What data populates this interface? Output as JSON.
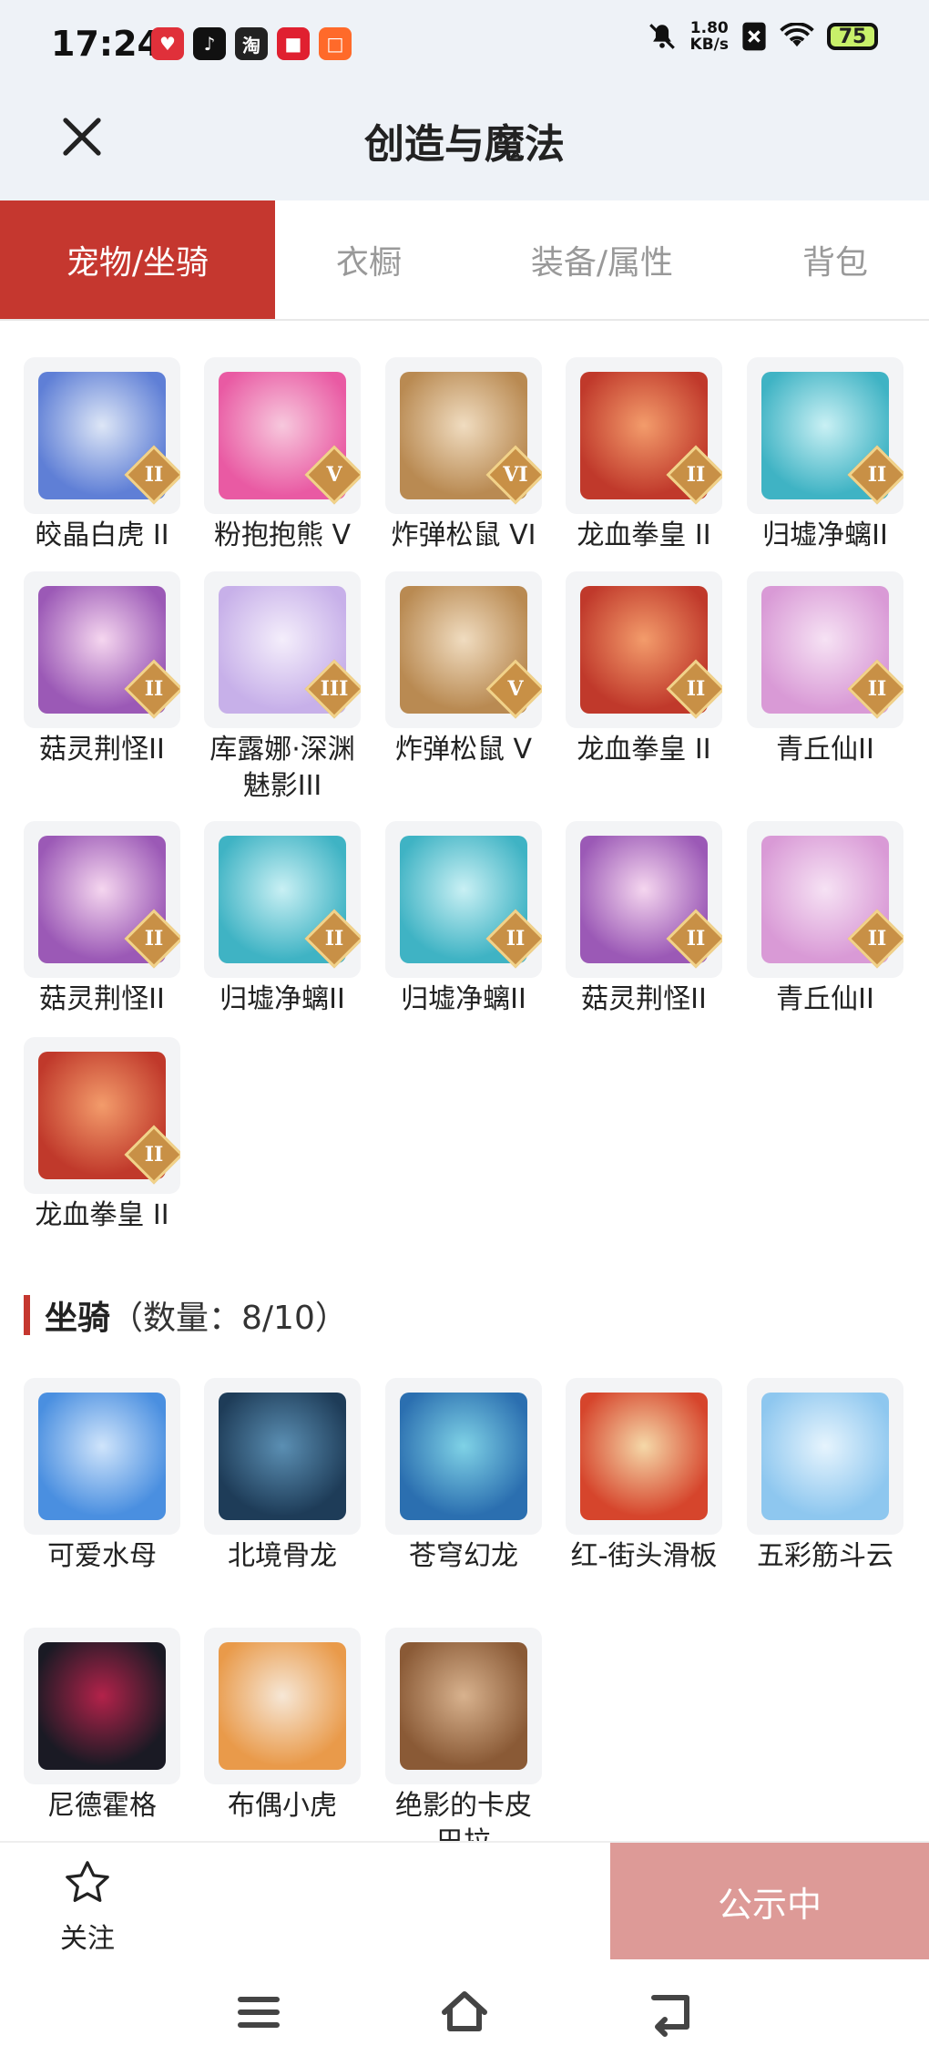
{
  "status_bar": {
    "time": "17:24",
    "net_speed_value": "1.80",
    "net_speed_unit": "KB/s",
    "battery": "75",
    "apps": [
      {
        "glyph": "♥",
        "color": "#e0303a"
      },
      {
        "glyph": "♪",
        "color": "#111111"
      },
      {
        "glyph": "淘",
        "color": "#222222"
      },
      {
        "glyph": "■",
        "color": "#e02030"
      },
      {
        "glyph": "□",
        "color": "#ff6a2a"
      }
    ]
  },
  "header": {
    "title": "创造与魔法"
  },
  "tabs": [
    {
      "label": "宠物/坐骑",
      "active": true
    },
    {
      "label": "衣橱",
      "active": false
    },
    {
      "label": "装备/属性",
      "active": false
    },
    {
      "label": "背包",
      "active": false
    }
  ],
  "pets": [
    {
      "name": "皎晶白虎 II",
      "badge": "II",
      "colors": [
        "#5f7fd6",
        "#dde6f6"
      ]
    },
    {
      "name": "粉抱抱熊 V",
      "badge": "V",
      "colors": [
        "#e95aa3",
        "#f7c8dd"
      ]
    },
    {
      "name": "炸弹松鼠 VI",
      "badge": "VI",
      "colors": [
        "#b98a52",
        "#f0dcc0"
      ]
    },
    {
      "name": "龙血拳皇 II",
      "badge": "II",
      "colors": [
        "#c0392b",
        "#f39c6b"
      ]
    },
    {
      "name": "归墟净螭II",
      "badge": "II",
      "colors": [
        "#3fb3c4",
        "#c9f0f4"
      ]
    },
    {
      "name": "菇灵荆怪II",
      "badge": "II",
      "colors": [
        "#9b59b6",
        "#f5d6ef"
      ]
    },
    {
      "name": "库露娜·深渊魅影III",
      "badge": "III",
      "colors": [
        "#c7b0e9",
        "#f4eefb"
      ]
    },
    {
      "name": "炸弹松鼠 V",
      "badge": "V",
      "colors": [
        "#b98a52",
        "#f0dcc0"
      ]
    },
    {
      "name": "龙血拳皇 II",
      "badge": "II",
      "colors": [
        "#c0392b",
        "#f39c6b"
      ]
    },
    {
      "name": "青丘仙II",
      "badge": "II",
      "colors": [
        "#d99ad6",
        "#f6e2f4"
      ]
    },
    {
      "name": "菇灵荆怪II",
      "badge": "II",
      "colors": [
        "#9b59b6",
        "#f5d6ef"
      ]
    },
    {
      "name": "归墟净螭II",
      "badge": "II",
      "colors": [
        "#3fb3c4",
        "#c9f0f4"
      ]
    },
    {
      "name": "归墟净螭II",
      "badge": "II",
      "colors": [
        "#3fb3c4",
        "#c9f0f4"
      ]
    },
    {
      "name": "菇灵荆怪II",
      "badge": "II",
      "colors": [
        "#9b59b6",
        "#f5d6ef"
      ]
    },
    {
      "name": "青丘仙II",
      "badge": "II",
      "colors": [
        "#d99ad6",
        "#f6e2f4"
      ]
    },
    {
      "name": "龙血拳皇 II",
      "badge": "II",
      "colors": [
        "#c0392b",
        "#f39c6b"
      ]
    }
  ],
  "mounts_section": {
    "title": "坐骑",
    "count_label": "（数量：8/10）"
  },
  "mounts": [
    {
      "name": "可爱水母",
      "colors": [
        "#4a8fe0",
        "#cfe4fb"
      ]
    },
    {
      "name": "北境骨龙",
      "colors": [
        "#1e3c58",
        "#5b8fb3"
      ]
    },
    {
      "name": "苍穹幻龙",
      "colors": [
        "#2b6fb0",
        "#7fd2e6"
      ]
    },
    {
      "name": "红-街头滑板",
      "colors": [
        "#d6452c",
        "#f5d8a8"
      ]
    },
    {
      "name": "五彩筋斗云",
      "colors": [
        "#8ec7ef",
        "#e6f4fd"
      ]
    },
    {
      "name": "尼德霍格",
      "colors": [
        "#1a1a24",
        "#b3224a"
      ]
    },
    {
      "name": "布偶小虎",
      "colors": [
        "#e99a4a",
        "#f6e7d6"
      ]
    },
    {
      "name": "绝影的卡皮巴拉",
      "colors": [
        "#8a5a36",
        "#d8b28e"
      ]
    }
  ],
  "bottom_bar": {
    "follow_label": "关注",
    "status_button": "公示中"
  }
}
